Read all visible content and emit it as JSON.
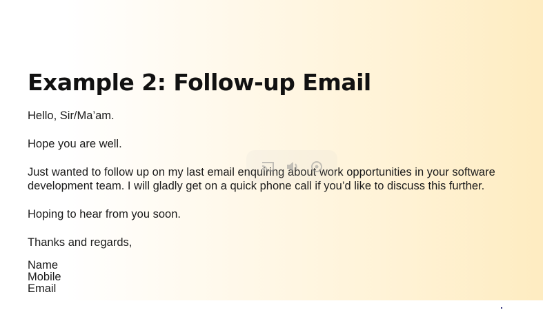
{
  "slide": {
    "title": "Example 2: Follow-up Email",
    "greeting": "Hello, Sir/Ma’am.",
    "line1": "Hope you are well.",
    "line2a": "Just wanted to follow up on my last email enquiring about work opportunities in your software",
    "line2b": "development team. I will gladly get on a quick phone call if you’d like to discuss this further.",
    "line3": "Hoping to hear from you soon.",
    "closing": "Thanks and regards,",
    "signature": [
      "Name",
      "Mobile",
      "Email"
    ]
  },
  "overlay": {
    "icons": [
      "cast-icon",
      "volume-icon",
      "settings-icon"
    ]
  }
}
